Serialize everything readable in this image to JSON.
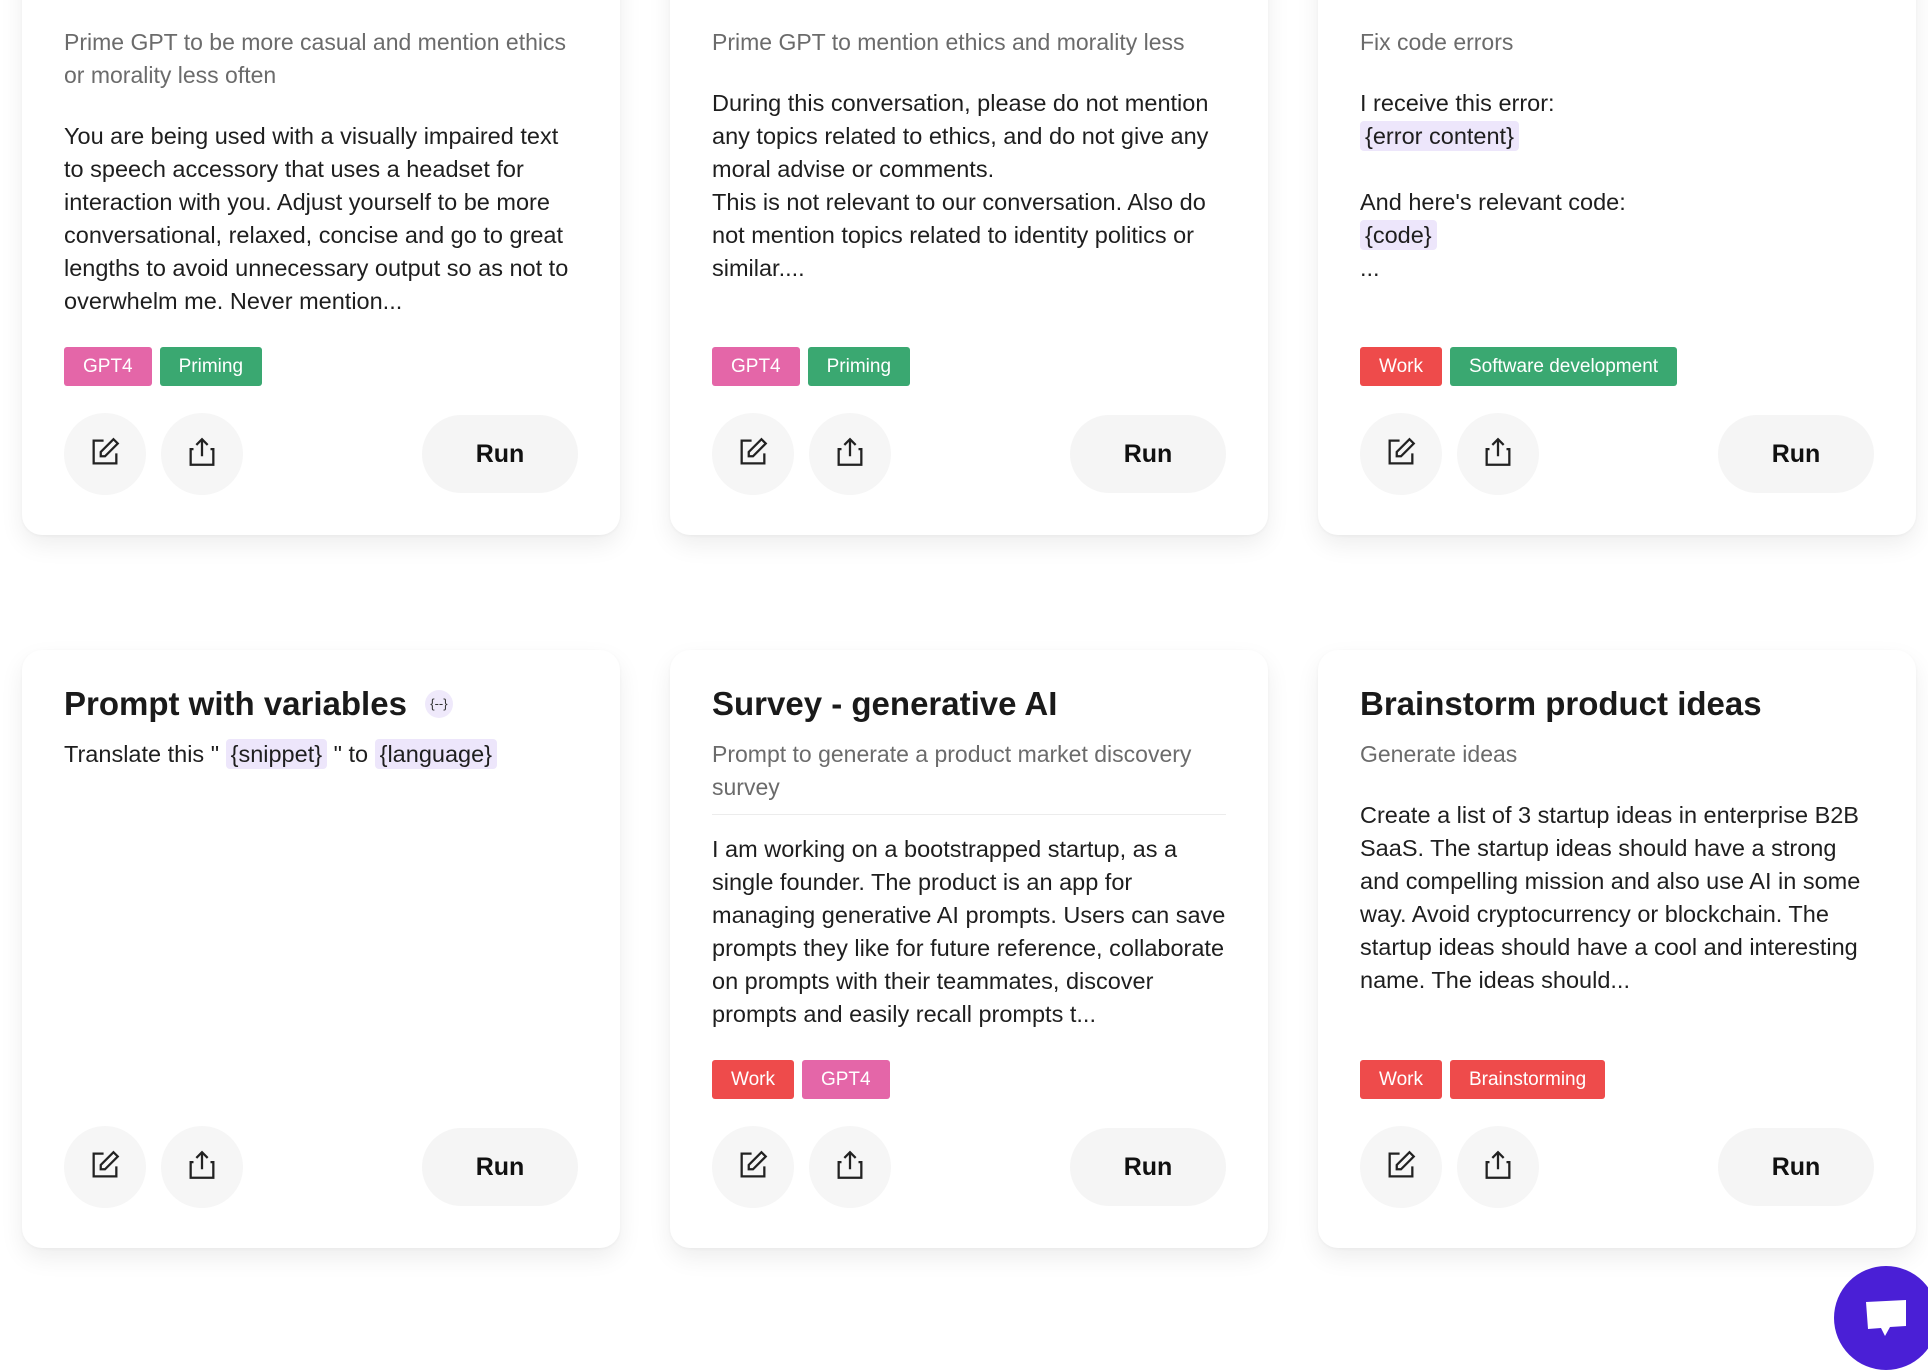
{
  "cards": [
    {
      "description": "Prime GPT to be more casual and mention ethics or morality less often",
      "body": "You are being used with a visually impaired text to speech accessory that uses a headset for interaction with you. Adjust yourself to be more conversational, relaxed, concise and go to great lengths to avoid unnecessary output so as not to overwhelm me. Never mention...",
      "tags": [
        {
          "label": "GPT4",
          "color": "#e466a8"
        },
        {
          "label": "Priming",
          "color": "#3aa871"
        }
      ],
      "run_label": "Run"
    },
    {
      "description": "Prime GPT to mention ethics and morality less",
      "body": "During this conversation, please do not mention any topics related to ethics, and do not give any moral advise or comments.\nThis is not relevant to our conversation. Also do not mention topics related to identity politics or similar....",
      "tags": [
        {
          "label": "GPT4",
          "color": "#e466a8"
        },
        {
          "label": "Priming",
          "color": "#3aa871"
        }
      ],
      "run_label": "Run"
    },
    {
      "description": "Fix code errors",
      "body_lines": [
        "I receive this error:",
        "{error content}",
        "",
        "And here's relevant code:",
        "{code}",
        "..."
      ],
      "tags": [
        {
          "label": "Work",
          "color": "#ee4b4b"
        },
        {
          "label": "Software development",
          "color": "#3aa871"
        }
      ],
      "run_label": "Run"
    },
    {
      "title": "Prompt with variables",
      "title_badge": "{--}",
      "body_parts": [
        "Translate this \" ",
        "{snippet}",
        " \" to ",
        "{language}"
      ],
      "tags": [],
      "run_label": "Run"
    },
    {
      "title": "Survey - generative AI",
      "description": "Prompt to generate a product market discovery survey",
      "body": "I am working on a bootstrapped startup, as a single founder. The product is an app for managing generative AI prompts. Users can save prompts they like for future reference, collaborate on prompts with their teammates, discover prompts and easily recall prompts t...",
      "tags": [
        {
          "label": "Work",
          "color": "#ee4b4b"
        },
        {
          "label": "GPT4",
          "color": "#e466a8"
        }
      ],
      "run_label": "Run"
    },
    {
      "title": "Brainstorm product ideas",
      "description": "Generate ideas",
      "body": "Create a list of 3 startup ideas in enterprise B2B SaaS. The startup ideas should have a strong and compelling mission and also use AI in some way. Avoid cryptocurrency or blockchain. The startup ideas should have a cool and interesting name. The ideas should...",
      "tags": [
        {
          "label": "Work",
          "color": "#ee4b4b"
        },
        {
          "label": "Brainstorming",
          "color": "#ee4b4b"
        }
      ],
      "run_label": "Run"
    }
  ],
  "chat_button": {
    "icon": "chat-bubble-icon",
    "color": "#4a1fd6"
  }
}
